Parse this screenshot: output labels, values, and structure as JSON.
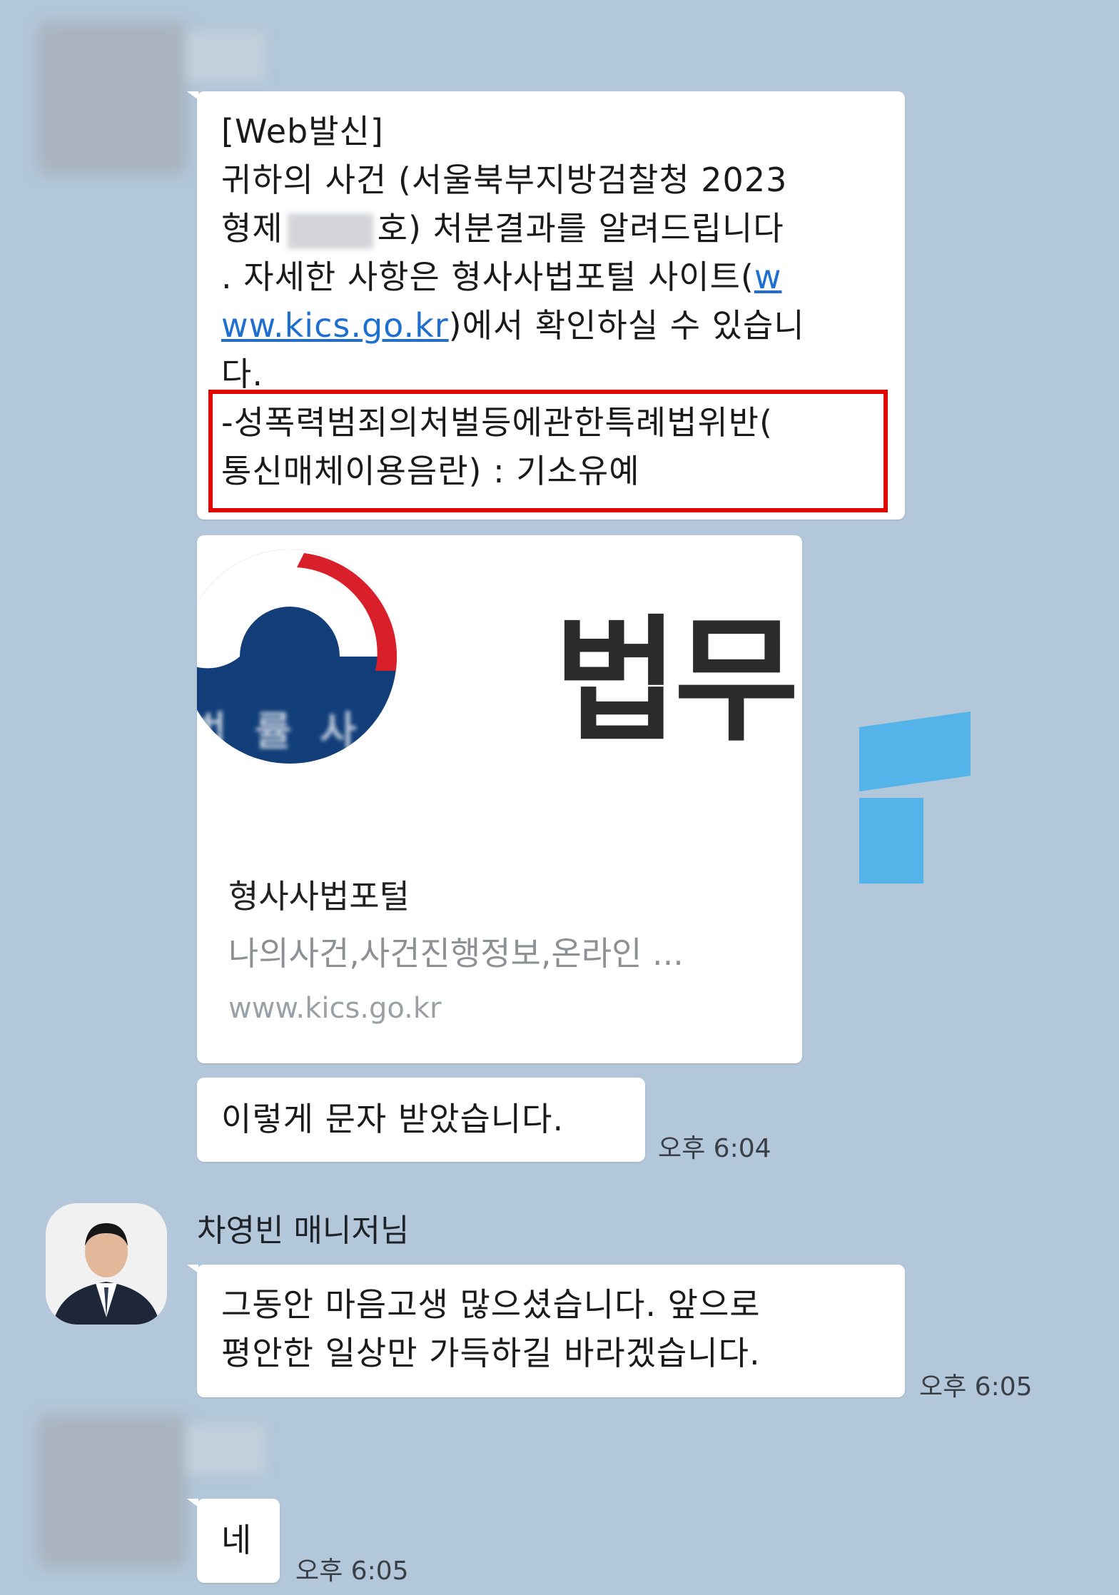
{
  "messages": [
    {
      "line1": "[Web발신]",
      "line2": "귀하의 사건 (서울북부지방검찰청 2023",
      "line3_pre": "형제",
      "line3_post": "호) 처분결과를 알려드립니다",
      "line4_pre": ". 자세한 사항은 형사사법포털 사이트(",
      "line4_link": "w",
      "line5_link": "ww.kics.go.kr",
      "line5_post": ")에서 확인하실 수 있습니",
      "line6": "다.",
      "line7": "-성폭력범죄의처벌등에관한특례법위반(",
      "line8": "통신매체이용음란) : 기소유예"
    }
  ],
  "link_card": {
    "logo_text": "법무",
    "title": "형사사법포털",
    "description": "나의사건,사건진행정보,온라인 ...",
    "url": "www.kics.go.kr",
    "watermark_small": "법 률 사 무 소",
    "emblem_colors": {
      "blue": "#123f7a",
      "red": "#d81f2a"
    },
    "watermark_accent": "#4fb3ea"
  },
  "sent_message": {
    "text": "이렇게 문자 받았습니다.",
    "time": "오후 6:04"
  },
  "manager": {
    "name": "차영빈 매니저님",
    "line1": "그동안 마음고생 많으셨습니다. 앞으로",
    "line2": "평안한 일상만 가득하길 바라겠습니다.",
    "time": "오후 6:05"
  },
  "reply": {
    "text": "네",
    "time": "오후 6:05"
  }
}
